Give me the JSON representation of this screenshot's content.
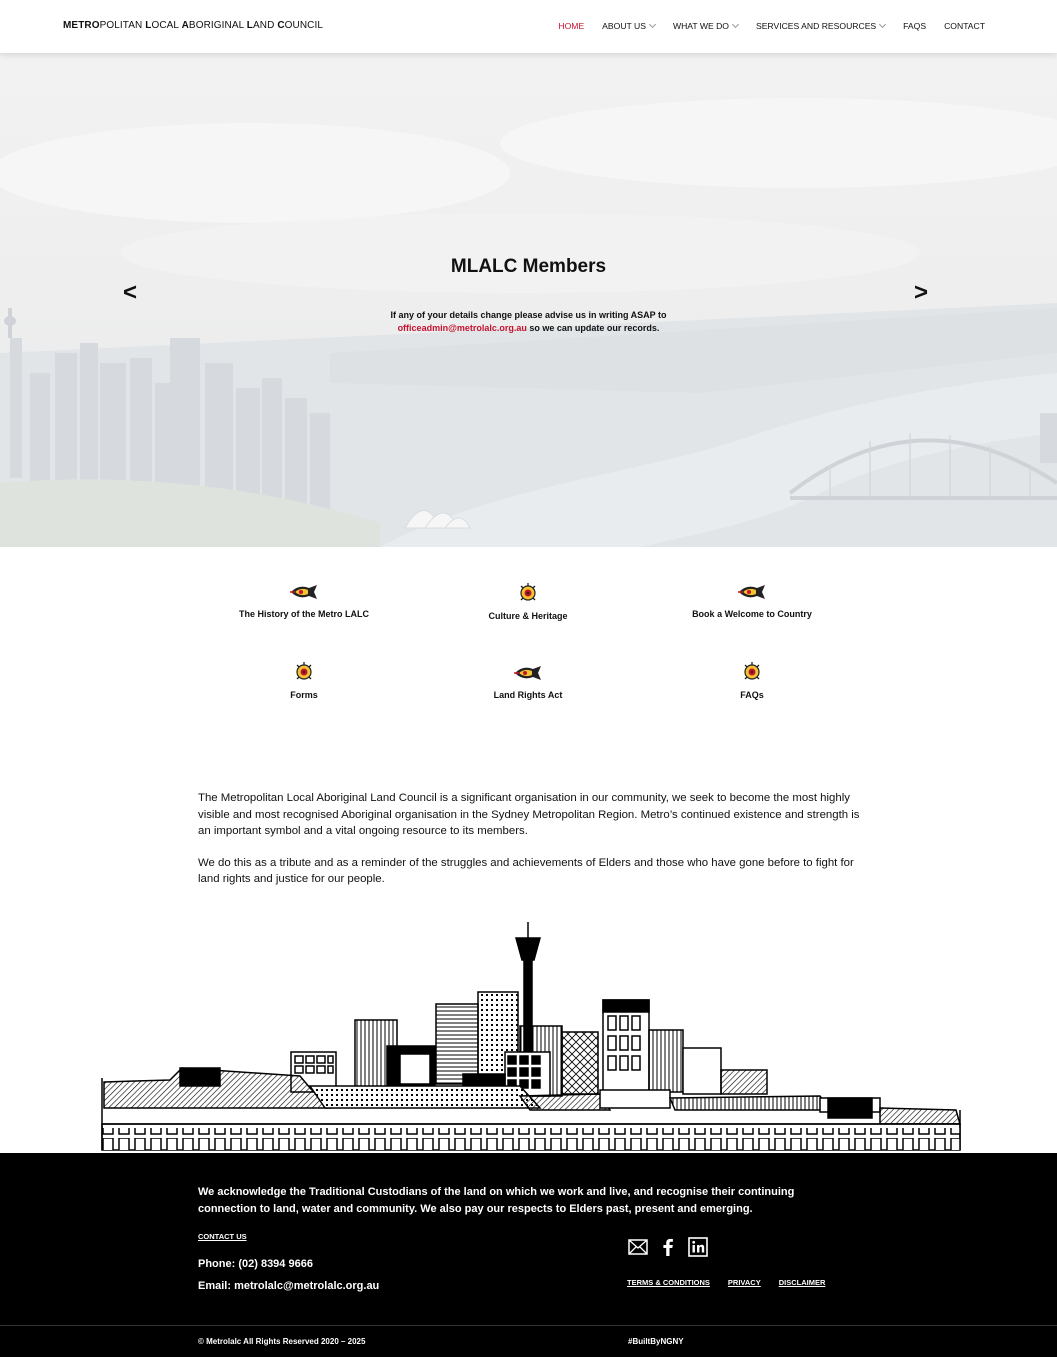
{
  "header": {
    "logo_parts": [
      "METRO",
      "POLITAN ",
      "L",
      "OCAL ",
      "A",
      "BORIGINAL ",
      "L",
      "AND ",
      "C",
      "OUNCIL"
    ],
    "nav": [
      {
        "label": "HOME",
        "active": true,
        "dropdown": false
      },
      {
        "label": "ABOUT US",
        "active": false,
        "dropdown": true
      },
      {
        "label": "WHAT WE DO",
        "active": false,
        "dropdown": true
      },
      {
        "label": "SERVICES AND RESOURCES",
        "active": false,
        "dropdown": true
      },
      {
        "label": "FAQS",
        "active": false,
        "dropdown": false
      },
      {
        "label": "CONTACT",
        "active": false,
        "dropdown": false
      }
    ]
  },
  "hero": {
    "title": "MLALC Members",
    "text_before": "If any of your details change please advise us in writing ASAP to",
    "email": "officeadmin@metrolalc.org.au",
    "text_after": " so we can update our records.",
    "prev_label": "<",
    "next_label": ">"
  },
  "tiles": [
    {
      "label": "The History of the Metro LALC",
      "icon": "fish-icon"
    },
    {
      "label": "Culture & Heritage",
      "icon": "turtle-icon"
    },
    {
      "label": "Book a Welcome to Country",
      "icon": "fish-icon"
    },
    {
      "label": "Forms",
      "icon": "turtle-icon"
    },
    {
      "label": "Land Rights Act",
      "icon": "fish-icon"
    },
    {
      "label": "FAQs",
      "icon": "turtle-icon"
    }
  ],
  "intro": {
    "p1": "The Metropolitan Local Aboriginal Land Council is a significant organisation in our community, we seek to become the most highly visible and most recognised Aboriginal organisation in the Sydney Metropolitan Region. Metro’s continued existence and strength is an important symbol and a vital ongoing resource to its members.",
    "p2": "We do this as a tribute and as a reminder of the struggles and achievements of Elders and those who have gone before to fight for land rights and justice for our people."
  },
  "footer": {
    "acknowledgement": "We acknowledge the Traditional Custodians of the land on which we work and live, and recognise their continuing connection to land, water and community. We also pay our respects to Elders past, present and emerging.",
    "contact_us": "CONTACT US",
    "phone": "Phone: (02) 8394 9666",
    "email": "Email: metrolalc@metrolalc.org.au",
    "legal": [
      "TERMS & CONDITIONS",
      "PRIVACY",
      "DISCLAIMER"
    ],
    "copyright": "© Metrolalc All Rights Reserved 2020 – 2025",
    "built_by": "#BuiltByNGNY",
    "social_icons": [
      "mail-icon",
      "facebook-icon",
      "linkedin-icon"
    ]
  },
  "colors": {
    "accent": "#c4122f",
    "footer_bg": "#000000"
  }
}
